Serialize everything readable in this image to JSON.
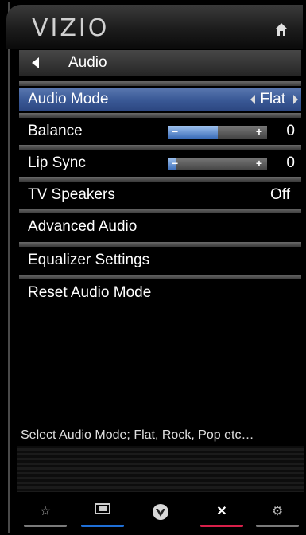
{
  "header": {
    "logo": "VIZIO",
    "home_icon": "home-icon"
  },
  "breadcrumb": {
    "title": "Audio"
  },
  "menu": [
    {
      "label": "Audio Mode",
      "value": "Flat",
      "type": "selector",
      "selected": true
    },
    {
      "label": "Balance",
      "value": "0",
      "type": "slider",
      "level": 0.5
    },
    {
      "label": "Lip Sync",
      "value": "0",
      "type": "slider",
      "level": 0.0
    },
    {
      "label": "TV Speakers",
      "value": "Off",
      "type": "value"
    },
    {
      "label": "Advanced Audio",
      "type": "link"
    },
    {
      "label": "Equalizer Settings",
      "type": "link"
    },
    {
      "label": "Reset Audio Mode",
      "type": "link"
    }
  ],
  "help_text": "Select Audio Mode; Flat, Rock, Pop etc…",
  "bottom_bar": [
    {
      "icon": "star-icon",
      "color": "#7a7a7a"
    },
    {
      "icon": "screen-icon",
      "color": "#1f6fd6"
    },
    {
      "icon": "vizio-v-icon",
      "color": "none"
    },
    {
      "icon": "close-icon",
      "color": "#d8204a"
    },
    {
      "icon": "gear-icon",
      "color": "#7a7a7a"
    }
  ],
  "colors": {
    "selected_row": "#3b5a97",
    "slider_fill": "#3a6cb8"
  }
}
